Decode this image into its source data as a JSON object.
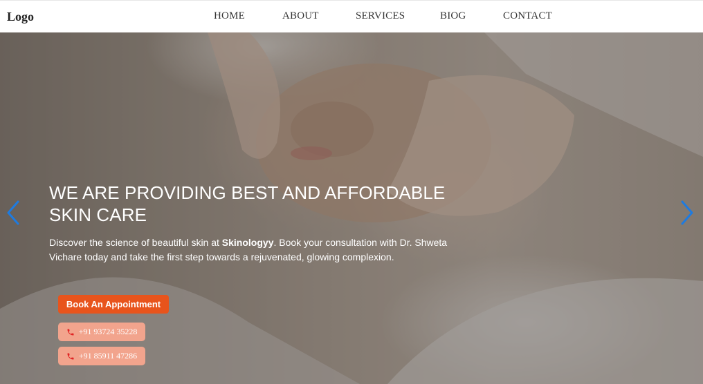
{
  "nav": {
    "logo": "Logo",
    "links": [
      "HOME",
      "ABOUT",
      "SERVICES",
      "BIOG",
      "CONTACT"
    ]
  },
  "hero": {
    "title_line1": "WE ARE PROVIDING BEST AND AFFORDABLE",
    "title_line2": "SKIN CARE",
    "desc_before": "Discover the science of beautiful skin at ",
    "desc_brand": "Skinologyy",
    "desc_after": ". Book your consultation with Dr. Shweta Vichare today and take the first step towards a rejuvenated, glowing complexion.",
    "book_label": "Book An Appointment",
    "phones": [
      "+91 93724 35228",
      "+91 85911 47286"
    ]
  },
  "colors": {
    "accent": "#e8541c",
    "phone_button": "#f2a48d",
    "arrow": "#1e7be0"
  },
  "icons": {
    "prev": "chevron-left-icon",
    "next": "chevron-right-icon",
    "phone": "phone-icon"
  }
}
